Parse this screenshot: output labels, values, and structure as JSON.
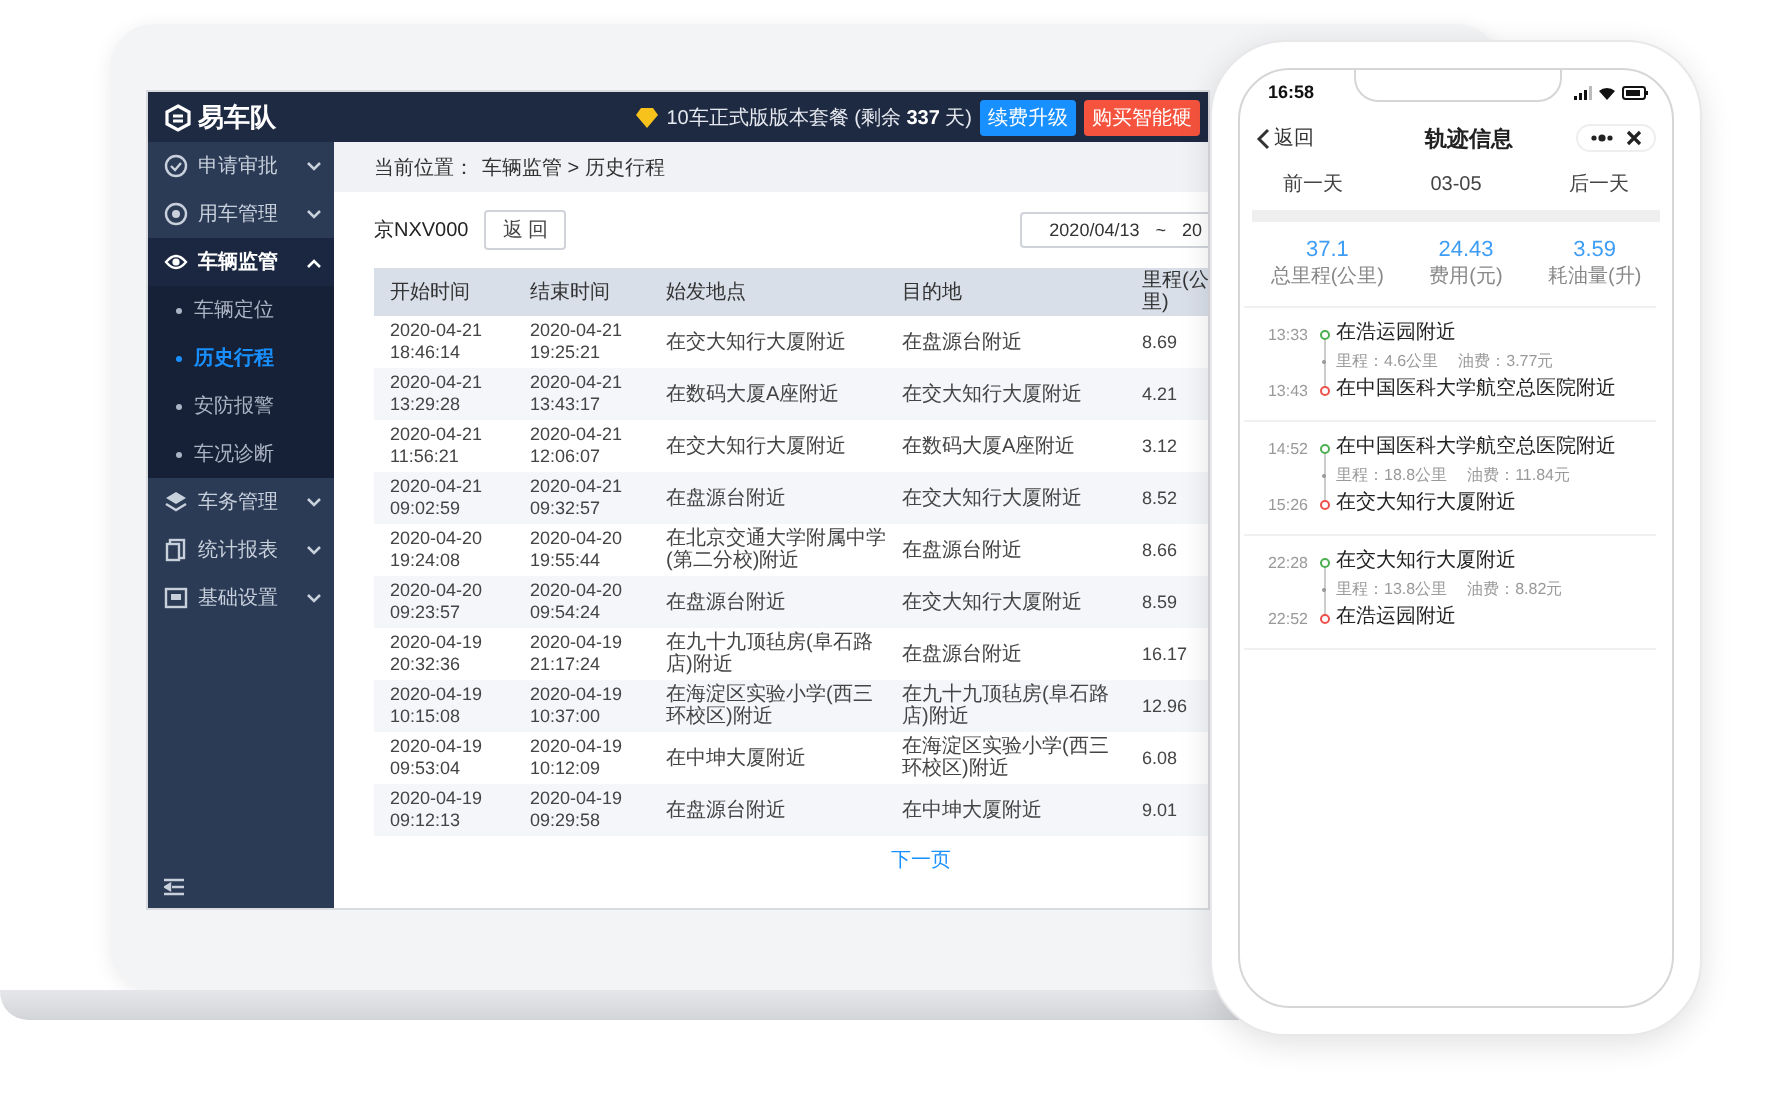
{
  "laptop": {
    "logo": "易车队",
    "plan_notice": "10车正式版版本套餐 (剩余 **337** 天)",
    "header_buttons": [
      {
        "label": "续费升级",
        "kind": "primary"
      },
      {
        "label": "购买智能硬",
        "kind": "danger"
      }
    ],
    "sidebar": {
      "items": [
        {
          "label": "申请审批",
          "expanded": false,
          "selected": false
        },
        {
          "label": "用车管理",
          "expanded": false,
          "selected": false
        },
        {
          "label": "车辆监管",
          "expanded": true,
          "selected": true,
          "children": [
            {
              "label": "车辆定位",
              "selected": false
            },
            {
              "label": "历史行程",
              "selected": true
            },
            {
              "label": "安防报警",
              "selected": false
            },
            {
              "label": "车况诊断",
              "selected": false
            }
          ]
        },
        {
          "label": "车务管理",
          "expanded": false,
          "selected": false
        },
        {
          "label": "统计报表",
          "expanded": false,
          "selected": false
        },
        {
          "label": "基础设置",
          "expanded": false,
          "selected": false
        }
      ]
    },
    "breadcrumb": {
      "label": "当前位置：",
      "trail": "车辆监管 > 历史行程"
    },
    "toolbar": {
      "plate": "京NXV000",
      "back_button": "返 回",
      "date_range": {
        "start": "2020/04/13",
        "separator": "~",
        "end": "20"
      }
    },
    "table": {
      "columns": [
        "开始时间",
        "结束时间",
        "始发地点",
        "目的地",
        "里程(公里)"
      ],
      "rows": [
        [
          "2020-04-21 18:46:14",
          "2020-04-21 19:25:21",
          "在交大知行大厦附近",
          "在盘源台附近",
          "8.69"
        ],
        [
          "2020-04-21 13:29:28",
          "2020-04-21 13:43:17",
          "在数码大厦A座附近",
          "在交大知行大厦附近",
          "4.21"
        ],
        [
          "2020-04-21 11:56:21",
          "2020-04-21 12:06:07",
          "在交大知行大厦附近",
          "在数码大厦A座附近",
          "3.12"
        ],
        [
          "2020-04-21 09:02:59",
          "2020-04-21 09:32:57",
          "在盘源台附近",
          "在交大知行大厦附近",
          "8.52"
        ],
        [
          "2020-04-20 19:24:08",
          "2020-04-20 19:55:44",
          "在北京交通大学附属中学(第二分校)附近",
          "在盘源台附近",
          "8.66"
        ],
        [
          "2020-04-20 09:23:57",
          "2020-04-20 09:54:24",
          "在盘源台附近",
          "在交大知行大厦附近",
          "8.59"
        ],
        [
          "2020-04-19 20:32:36",
          "2020-04-19 21:17:24",
          "在九十九顶毡房(阜石路店)附近",
          "在盘源台附近",
          "16.17"
        ],
        [
          "2020-04-19 10:15:08",
          "2020-04-19 10:37:00",
          "在海淀区实验小学(西三环校区)附近",
          "在九十九顶毡房(阜石路店)附近",
          "12.96"
        ],
        [
          "2020-04-19 09:53:04",
          "2020-04-19 10:12:09",
          "在中坤大厦附近",
          "在海淀区实验小学(西三环校区)附近",
          "6.08"
        ],
        [
          "2020-04-19 09:12:13",
          "2020-04-19 09:29:58",
          "在盘源台附近",
          "在中坤大厦附近",
          "9.01"
        ]
      ]
    },
    "pagination": {
      "next": "下一页"
    }
  },
  "phone": {
    "status_bar": {
      "time": "16:58"
    },
    "nav": {
      "back": "返回",
      "title": "轨迹信息"
    },
    "day_nav": [
      "前一天",
      "03-05",
      "后一天"
    ],
    "stats": [
      {
        "value": "37.1",
        "label": "总里程(公里)"
      },
      {
        "value": "24.43",
        "label": "费用(元)"
      },
      {
        "value": "3.59",
        "label": "耗油量(升)"
      }
    ],
    "trips": [
      {
        "start_time": "13:33",
        "start": "在浩运园附近",
        "mileage": "里程：4.6公里",
        "cost": "油费：3.77元",
        "end_time": "13:43",
        "end": "在中国医科大学航空总医院附近"
      },
      {
        "start_time": "14:52",
        "start": "在中国医科大学航空总医院附近",
        "mileage": "里程：18.8公里",
        "cost": "油费：11.84元",
        "end_time": "15:26",
        "end": "在交大知行大厦附近"
      },
      {
        "start_time": "22:28",
        "start": "在交大知行大厦附近",
        "mileage": "里程：13.8公里",
        "cost": "油费：8.82元",
        "end_time": "22:52",
        "end": "在浩运园附近"
      }
    ]
  }
}
